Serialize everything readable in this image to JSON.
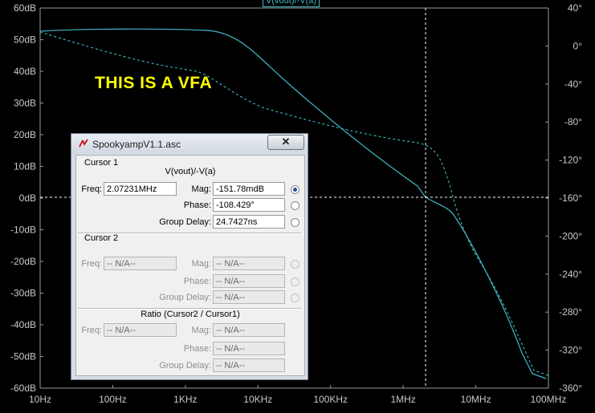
{
  "plot": {
    "trace_title": "V(vout)/-V(a)",
    "annotation": "THIS IS A VFA",
    "left_axis_labels": [
      "60dB",
      "50dB",
      "40dB",
      "30dB",
      "20dB",
      "10dB",
      "0dB",
      "-10dB",
      "-20dB",
      "-30dB",
      "-40dB",
      "-50dB",
      "-60dB"
    ],
    "right_axis_labels": [
      "40°",
      "0°",
      "-40°",
      "-80°",
      "-120°",
      "-160°",
      "-200°",
      "-240°",
      "-280°",
      "-320°",
      "-360°"
    ],
    "x_axis_labels": [
      "10Hz",
      "100Hz",
      "1KHz",
      "10KHz",
      "100KHz",
      "1MHz",
      "10MHz",
      "100MHz"
    ],
    "trace_color": "#3fb9c8",
    "cursor_color": "#ffffff"
  },
  "dialog": {
    "title": "SpookyampV1.1.asc",
    "close_glyph": "✕",
    "cursor1": {
      "label": "Cursor 1",
      "expression": "V(vout)/-V(a)",
      "freq_label": "Freq:",
      "freq_value": "2.07231MHz",
      "mag_label": "Mag:",
      "mag_value": "-151.78mdB",
      "phase_label": "Phase:",
      "phase_value": "-108.429°",
      "group_delay_label": "Group Delay:",
      "group_delay_value": "24.7427ns"
    },
    "cursor2": {
      "label": "Cursor 2",
      "freq_label": "Freq:",
      "freq_value": "-- N/A--",
      "mag_label": "Mag:",
      "mag_value": "-- N/A--",
      "phase_label": "Phase:",
      "phase_value": "-- N/A--",
      "group_delay_label": "Group Delay:",
      "group_delay_value": "-- N/A--"
    },
    "ratio": {
      "label": "Ratio (Cursor2 / Cursor1)",
      "freq_label": "Freq:",
      "freq_value": "-- N/A--",
      "mag_label": "Mag:",
      "mag_value": "-- N/A--",
      "phase_label": "Phase:",
      "phase_value": "-- N/A--",
      "group_delay_label": "Group Delay:",
      "group_delay_value": "-- N/A--"
    }
  }
}
